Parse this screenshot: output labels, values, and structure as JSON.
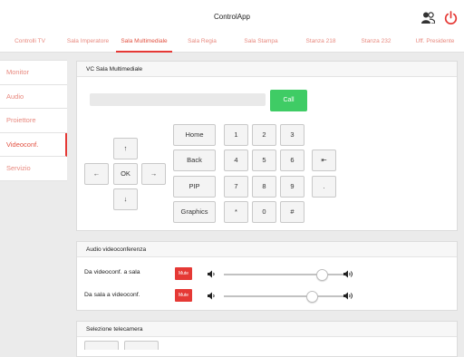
{
  "app": {
    "title": "ControlApp",
    "icons": {
      "users": "users-icon",
      "power": "power-icon"
    },
    "accent": "#e53935"
  },
  "tabs": [
    {
      "label": "Controlli TV"
    },
    {
      "label": "Sala Imperatore"
    },
    {
      "label": "Sala Multimediale",
      "active": true
    },
    {
      "label": "Sala Regia"
    },
    {
      "label": "Sala Stampa"
    },
    {
      "label": "Stanza 218"
    },
    {
      "label": "Stanza 232"
    },
    {
      "label": "Uff. Presidente"
    }
  ],
  "sidebar": {
    "items": [
      {
        "label": "Monitor"
      },
      {
        "label": "Audio"
      },
      {
        "label": "Proiettore"
      },
      {
        "label": "Videoconf.",
        "active": true
      },
      {
        "label": "Servizio"
      }
    ]
  },
  "vc": {
    "title": "VC Sala Multimediale",
    "call_label": "Call",
    "dpad": {
      "up": "↑",
      "down": "↓",
      "left": "←",
      "right": "→",
      "ok": "OK"
    },
    "functions": [
      "Home",
      "Back",
      "PIP",
      "Graphics"
    ],
    "keypad": [
      "1",
      "2",
      "3",
      "4",
      "5",
      "6",
      "7",
      "8",
      "9",
      "*",
      "0",
      "#"
    ],
    "extra": {
      "backspace": "⇤",
      "dot": "."
    }
  },
  "audio": {
    "title": "Audio videoconferenza",
    "rows": [
      {
        "label": "Da videoconf. a sala",
        "mute_label": "Mute",
        "level": 0.81
      },
      {
        "label": "Da sala a videoconf.",
        "mute_label": "Mute",
        "level": 0.73
      }
    ]
  },
  "camera": {
    "title": "Selezione telecamera"
  }
}
